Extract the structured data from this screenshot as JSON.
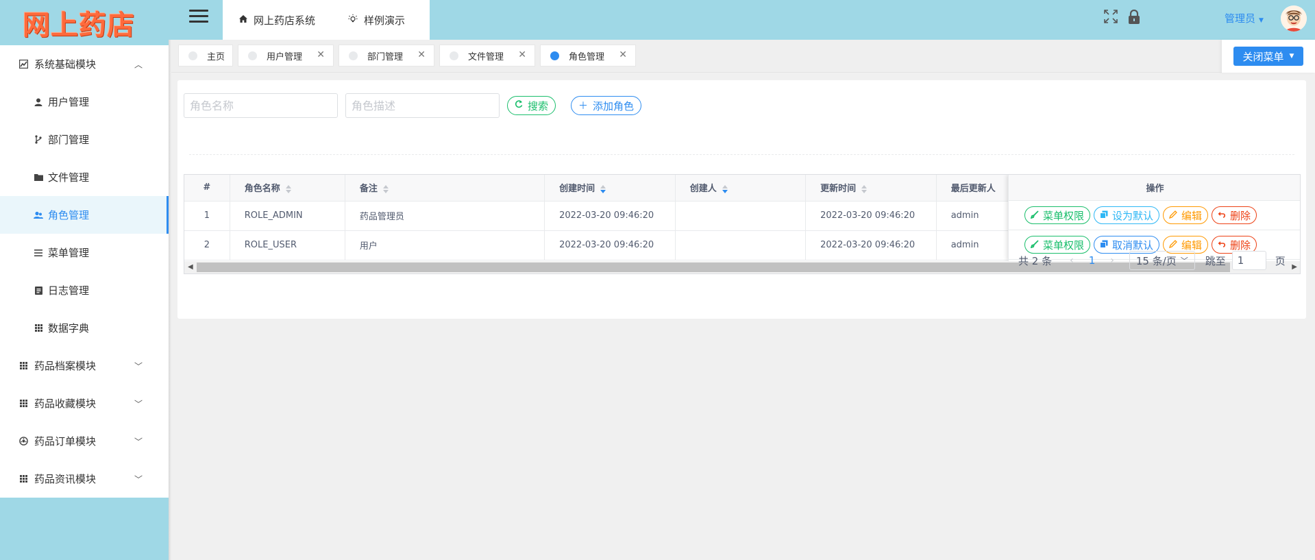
{
  "app": {
    "logo_text": "网上药店"
  },
  "sidebar": {
    "groups": [
      {
        "label": "系统基础模块",
        "icon": "chart-icon",
        "expanded": true,
        "items": [
          {
            "label": "用户管理",
            "icon": "user-icon"
          },
          {
            "label": "部门管理",
            "icon": "branch-icon"
          },
          {
            "label": "文件管理",
            "icon": "folder-icon"
          },
          {
            "label": "角色管理",
            "icon": "users-icon",
            "active": true
          },
          {
            "label": "菜单管理",
            "icon": "list-icon"
          },
          {
            "label": "日志管理",
            "icon": "log-icon"
          },
          {
            "label": "数据字典",
            "icon": "grid-icon"
          }
        ]
      },
      {
        "label": "药品档案模块",
        "icon": "grid-icon"
      },
      {
        "label": "药品收藏模块",
        "icon": "grid-icon"
      },
      {
        "label": "药品订单模块",
        "icon": "dial-icon"
      },
      {
        "label": "药品资讯模块",
        "icon": "grid-icon"
      }
    ]
  },
  "header": {
    "tabs": [
      {
        "label": "网上药店系统",
        "icon": "home-icon"
      },
      {
        "label": "样例演示",
        "icon": "bulb-icon"
      }
    ],
    "user_name": "管理员"
  },
  "page_tabs": [
    {
      "label": "主页",
      "closable": false
    },
    {
      "label": "用户管理",
      "closable": true
    },
    {
      "label": "部门管理",
      "closable": true
    },
    {
      "label": "文件管理",
      "closable": true
    },
    {
      "label": "角色管理",
      "closable": true,
      "active": true
    }
  ],
  "close_menu_label": "关闭菜单",
  "search": {
    "name_placeholder": "角色名称",
    "desc_placeholder": "角色描述",
    "search_label": "搜索",
    "add_label": "添加角色"
  },
  "table": {
    "columns": [
      "#",
      "角色名称",
      "备注",
      "创建时间",
      "创建人",
      "更新时间",
      "最后更新人",
      "操作"
    ],
    "rows": [
      {
        "index": "1",
        "name": "ROLE_ADMIN",
        "remark": "药品管理员",
        "created": "2022-03-20 09:46:20",
        "creator": "",
        "updated": "2022-03-20 09:46:20",
        "updater": "admin",
        "default_action": "设为默认"
      },
      {
        "index": "2",
        "name": "ROLE_USER",
        "remark": "用户",
        "created": "2022-03-20 09:46:20",
        "creator": "",
        "updated": "2022-03-20 09:46:20",
        "updater": "admin",
        "default_action": "取消默认"
      }
    ],
    "actions": {
      "perm": "菜单权限",
      "edit": "编辑",
      "delete": "删除"
    }
  },
  "pagination": {
    "total_text": "共 2 条",
    "current_page": "1",
    "page_size": "15 条/页",
    "jump_label": "跳至",
    "jump_value": "1",
    "page_suffix": "页"
  },
  "colors": {
    "primary": "#2d8cf0",
    "success": "#19be6b",
    "info": "#2db7f5",
    "warning": "#ff9900",
    "error": "#ed4014",
    "topbar": "#9fd8e6"
  }
}
